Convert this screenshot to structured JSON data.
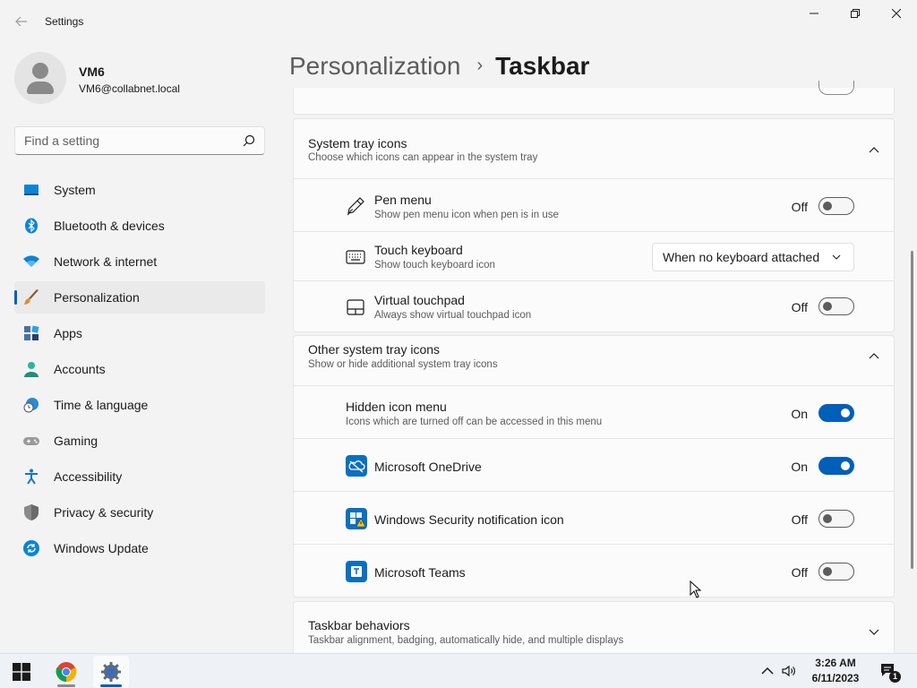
{
  "window": {
    "title": "Settings",
    "back_icon": "back-arrow-icon",
    "minimize_icon": "minimize-icon",
    "maximize_icon": "restore-icon",
    "close_icon": "close-icon"
  },
  "user": {
    "name": "VM6",
    "email": "VM6@collabnet.local"
  },
  "search": {
    "placeholder": "Find a setting",
    "icon": "search-icon"
  },
  "nav": {
    "items": [
      {
        "label": "System",
        "icon": "system-icon",
        "color": "#0078d4"
      },
      {
        "label": "Bluetooth & devices",
        "icon": "bluetooth-icon",
        "color": "#0078d4"
      },
      {
        "label": "Network & internet",
        "icon": "wifi-icon",
        "color": "#0078d4"
      },
      {
        "label": "Personalization",
        "icon": "paintbrush-icon",
        "color": "#d9813a",
        "active": true
      },
      {
        "label": "Apps",
        "icon": "apps-icon",
        "color": "#4a6fa5"
      },
      {
        "label": "Accounts",
        "icon": "accounts-icon",
        "color": "#2bb59a"
      },
      {
        "label": "Time & language",
        "icon": "globe-clock-icon",
        "color": "#0078d4"
      },
      {
        "label": "Gaming",
        "icon": "gamepad-icon",
        "color": "#8a8a8a"
      },
      {
        "label": "Accessibility",
        "icon": "accessibility-icon",
        "color": "#1a73c7"
      },
      {
        "label": "Privacy & security",
        "icon": "shield-icon",
        "color": "#7a7a7a"
      },
      {
        "label": "Windows Update",
        "icon": "update-icon",
        "color": "#0078d4"
      }
    ]
  },
  "breadcrumb": {
    "parent": "Personalization",
    "separator": "›",
    "current": "Taskbar"
  },
  "system_tray": {
    "title": "System tray icons",
    "description": "Choose which icons can appear in the system tray",
    "rows": [
      {
        "title": "Pen menu",
        "description": "Show pen menu icon when pen is in use",
        "icon": "pen-icon",
        "state": "Off",
        "on": false
      },
      {
        "title": "Touch keyboard",
        "description": "Show touch keyboard icon",
        "icon": "keyboard-icon",
        "dropdown_value": "When no keyboard attached"
      },
      {
        "title": "Virtual touchpad",
        "description": "Always show virtual touchpad icon",
        "icon": "touchpad-icon",
        "state": "Off",
        "on": false
      }
    ]
  },
  "other_tray": {
    "title": "Other system tray icons",
    "description": "Show or hide additional system tray icons",
    "hidden_menu": {
      "title": "Hidden icon menu",
      "description": "Icons which are turned off can be accessed in this menu",
      "state": "On",
      "on": true
    },
    "apps": [
      {
        "title": "Microsoft OneDrive",
        "icon": "onedrive-icon",
        "state": "On",
        "on": true
      },
      {
        "title": "Windows Security notification icon",
        "icon": "windows-security-icon",
        "state": "Off",
        "on": false
      },
      {
        "title": "Microsoft Teams",
        "icon": "teams-icon",
        "state": "Off",
        "on": false
      }
    ]
  },
  "taskbar_behaviors": {
    "title": "Taskbar behaviors",
    "description": "Taskbar alignment, badging, automatically hide, and multiple displays"
  },
  "taskbar": {
    "start_icon": "windows-start-icon",
    "apps": [
      "chrome-icon",
      "settings-gear-icon"
    ],
    "time": "3:26 AM",
    "date": "6/11/2023",
    "notification_count": "1",
    "tray_icons": [
      "chevron-up-icon",
      "speaker-icon",
      "notification-icon"
    ]
  },
  "colors": {
    "accent": "#005fb8",
    "background": "#f3f3f3",
    "card": "#fbfbfb"
  }
}
